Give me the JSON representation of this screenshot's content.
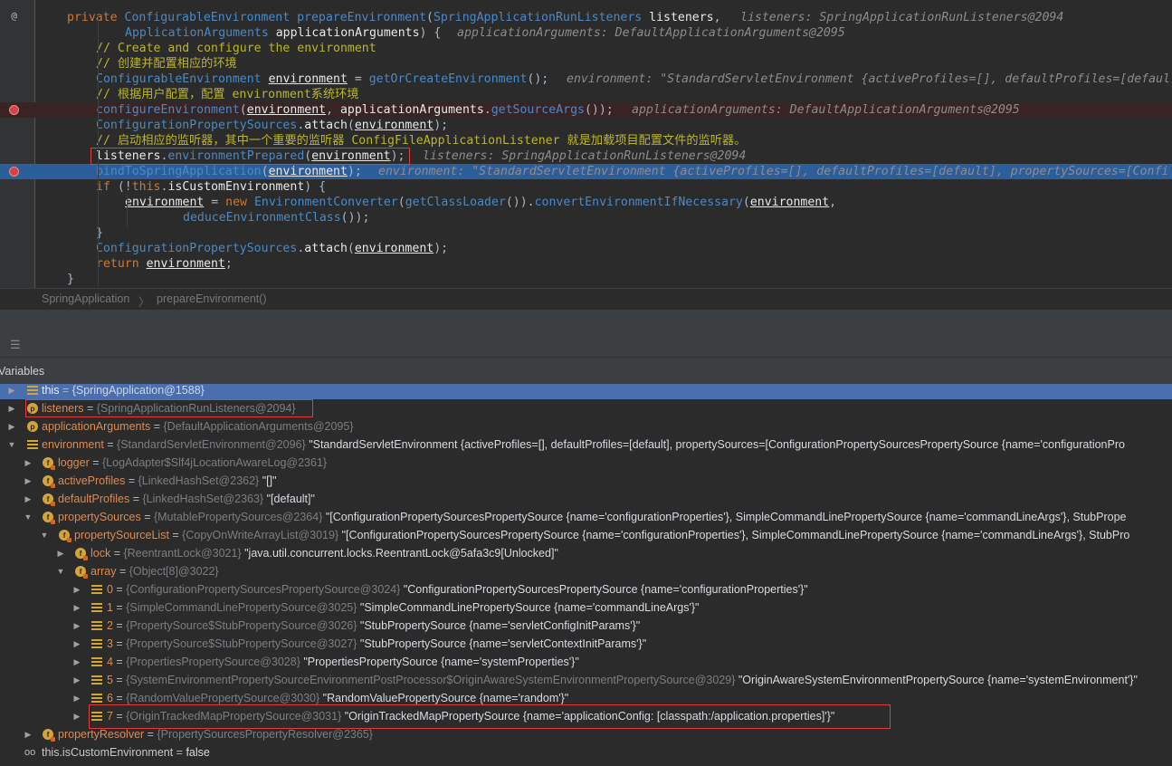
{
  "editor": {
    "lines": [
      {
        "text": "private ConfigurableEnvironment prepareEnvironment(SpringApplicationRunListeners listeners,",
        "hint": "listeners: SpringApplicationRunListeners@2094"
      },
      {
        "text": "ApplicationArguments applicationArguments) {",
        "hint": "applicationArguments: DefaultApplicationArguments@2095"
      },
      {
        "text": "// Create and configure the environment"
      },
      {
        "text": "// 创建并配置相应的环境"
      },
      {
        "text": "ConfigurableEnvironment environment = getOrCreateEnvironment();",
        "hint": "environment: \"StandardServletEnvironment {activeProfiles=[], defaultProfiles=[defaul"
      },
      {
        "text": "// 根据用户配置，配置 environment系统环境"
      },
      {
        "text": "configureEnvironment(environment, applicationArguments.getSourceArgs());",
        "hint": "applicationArguments: DefaultApplicationArguments@2095"
      },
      {
        "text": "ConfigurationPropertySources.attach(environment);"
      },
      {
        "text": "// 启动相应的监听器，其中一个重要的监听器 ConfigFileApplicationListener 就是加载项目配置文件的监听器。"
      },
      {
        "text": "listeners.environmentPrepared(environment);",
        "hint": "listeners: SpringApplicationRunListeners@2094"
      },
      {
        "text": "bindToSpringApplication(environment);",
        "hint": "environment: \"StandardServletEnvironment {activeProfiles=[], defaultProfiles=[default], propertySources=[Confi"
      },
      {
        "text": "if (!this.isCustomEnvironment) {"
      },
      {
        "text": "environment = new EnvironmentConverter(getClassLoader()).convertEnvironmentIfNecessary(environment,"
      },
      {
        "text": "deduceEnvironmentClass());"
      },
      {
        "text": "}"
      },
      {
        "text": "ConfigurationPropertySources.attach(environment);"
      },
      {
        "text": "return environment;"
      },
      {
        "text": "}"
      }
    ],
    "gutter_at": "@"
  },
  "breadcrumb": {
    "class_name": "SpringApplication",
    "separator": "〉",
    "method_name": "prepareEnvironment()"
  },
  "debugger": {
    "toolbar_icon": "restore-layout-icon",
    "variables_title": "Variables",
    "rows": [
      {
        "name": "this",
        "type": "{SpringApplication@1588}",
        "value": ""
      },
      {
        "name": "listeners",
        "type": "{SpringApplicationRunListeners@2094}",
        "value": ""
      },
      {
        "name": "applicationArguments",
        "type": "{DefaultApplicationArguments@2095}",
        "value": ""
      },
      {
        "name": "environment",
        "type": "{StandardServletEnvironment@2096}",
        "value": "\"StandardServletEnvironment {activeProfiles=[], defaultProfiles=[default], propertySources=[ConfigurationPropertySourcesPropertySource {name='configurationPro"
      },
      {
        "name": "logger",
        "type": "{LogAdapter$Slf4jLocationAwareLog@2361}",
        "value": ""
      },
      {
        "name": "activeProfiles",
        "type": "{LinkedHashSet@2362}",
        "value": "\"[]\""
      },
      {
        "name": "defaultProfiles",
        "type": "{LinkedHashSet@2363}",
        "value": "\"[default]\""
      },
      {
        "name": "propertySources",
        "type": "{MutablePropertySources@2364}",
        "value": "\"[ConfigurationPropertySourcesPropertySource {name='configurationProperties'}, SimpleCommandLinePropertySource {name='commandLineArgs'}, StubPrope"
      },
      {
        "name": "propertySourceList",
        "type": "{CopyOnWriteArrayList@3019}",
        "value": "\"[ConfigurationPropertySourcesPropertySource {name='configurationProperties'}, SimpleCommandLinePropertySource {name='commandLineArgs'}, StubPro"
      },
      {
        "name": "lock",
        "type": "{ReentrantLock@3021}",
        "value": "\"java.util.concurrent.locks.ReentrantLock@5afa3c9[Unlocked]\""
      },
      {
        "name": "array",
        "type": "{Object[8]@3022}",
        "value": ""
      },
      {
        "name": "0",
        "type": "{ConfigurationPropertySourcesPropertySource@3024}",
        "value": "\"ConfigurationPropertySourcesPropertySource {name='configurationProperties'}\""
      },
      {
        "name": "1",
        "type": "{SimpleCommandLinePropertySource@3025}",
        "value": "\"SimpleCommandLinePropertySource {name='commandLineArgs'}\""
      },
      {
        "name": "2",
        "type": "{PropertySource$StubPropertySource@3026}",
        "value": "\"StubPropertySource {name='servletConfigInitParams'}\""
      },
      {
        "name": "3",
        "type": "{PropertySource$StubPropertySource@3027}",
        "value": "\"StubPropertySource {name='servletContextInitParams'}\""
      },
      {
        "name": "4",
        "type": "{PropertiesPropertySource@3028}",
        "value": "\"PropertiesPropertySource {name='systemProperties'}\""
      },
      {
        "name": "5",
        "type": "{SystemEnvironmentPropertySourceEnvironmentPostProcessor$OriginAwareSystemEnvironmentPropertySource@3029}",
        "value": "\"OriginAwareSystemEnvironmentPropertySource {name='systemEnvironment'}\""
      },
      {
        "name": "6",
        "type": "{RandomValuePropertySource@3030}",
        "value": "\"RandomValuePropertySource {name='random'}\""
      },
      {
        "name": "7",
        "type": "{OriginTrackedMapPropertySource@3031}",
        "value": "\"OriginTrackedMapPropertySource {name='applicationConfig: [classpath:/application.properties]'}\""
      },
      {
        "name": "propertyResolver",
        "type": "{PropertySourcesPropertyResolver@2365}",
        "value": ""
      },
      {
        "name": "this.isCustomEnvironment",
        "type": "",
        "value": "false"
      }
    ]
  },
  "colors": {
    "editor_bg": "#2b2b2b",
    "selection": "#2d5e9c",
    "breakpoint_line": "#3a2323",
    "highlight_box": "#e03c3c",
    "selected_row": "#4b6eaf"
  }
}
